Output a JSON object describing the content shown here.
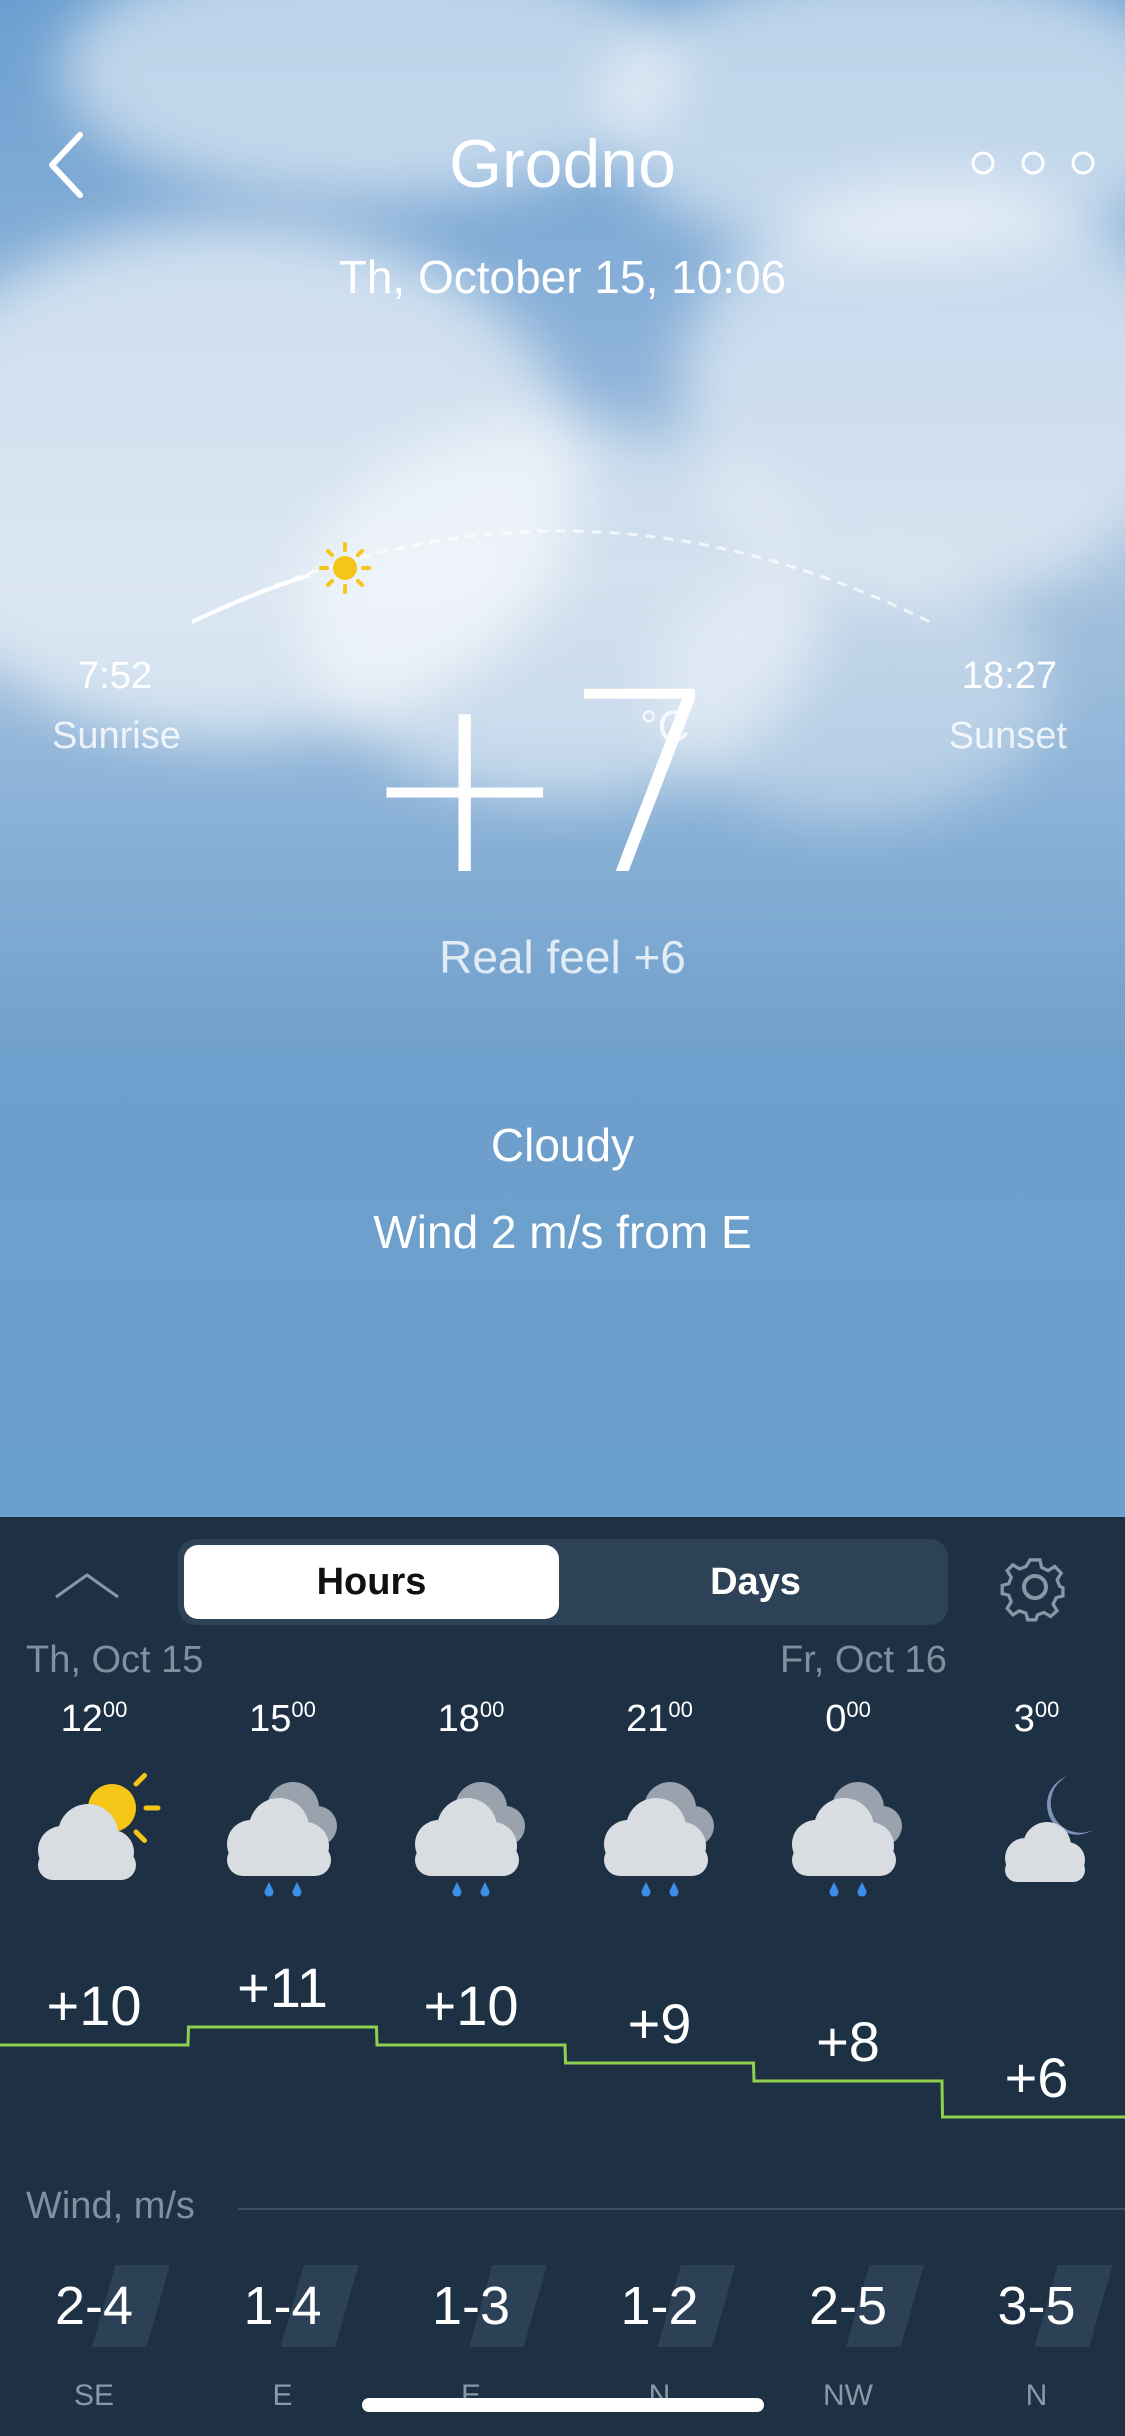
{
  "header": {
    "city": "Grodno",
    "datetime": "Th, October 15, 10:06"
  },
  "sun": {
    "sunrise_time": "7:52",
    "sunrise_label": "Sunrise",
    "sunset_time": "18:27",
    "sunset_label": "Sunset"
  },
  "current": {
    "temperature": "+7",
    "unit": "°C",
    "real_feel": "Real feel +6",
    "condition": "Cloudy",
    "wind": "Wind 2 m/s from E"
  },
  "tabs": {
    "hours": "Hours",
    "days": "Days",
    "active": "Hours"
  },
  "forecast": {
    "day_labels": [
      "Th, Oct 15",
      "Fr, Oct 16"
    ],
    "hours": [
      {
        "hour": "12",
        "minutes": "00",
        "icon": "partly-sunny-icon",
        "temp": "+10",
        "temp_value": 10,
        "wind": "2-4",
        "dir": "SE"
      },
      {
        "hour": "15",
        "minutes": "00",
        "icon": "cloud-rain-icon",
        "temp": "+11",
        "temp_value": 11,
        "wind": "1-4",
        "dir": "E"
      },
      {
        "hour": "18",
        "minutes": "00",
        "icon": "cloud-rain-icon",
        "temp": "+10",
        "temp_value": 10,
        "wind": "1-3",
        "dir": "E"
      },
      {
        "hour": "21",
        "minutes": "00",
        "icon": "cloud-rain-icon",
        "temp": "+9",
        "temp_value": 9,
        "wind": "1-2",
        "dir": "N"
      },
      {
        "hour": "0",
        "minutes": "00",
        "icon": "cloud-rain-icon",
        "temp": "+8",
        "temp_value": 8,
        "wind": "2-5",
        "dir": "NW"
      },
      {
        "hour": "3",
        "minutes": "00",
        "icon": "moon-cloud-icon",
        "temp": "+6",
        "temp_value": 6,
        "wind": "3-5",
        "dir": "N"
      }
    ]
  },
  "wind_section": {
    "header": "Wind, m/s"
  },
  "colors": {
    "panel": "#1d3044",
    "graph_line": "#8fd14f",
    "sun": "#f5c518",
    "rain": "#3b8fe8"
  }
}
